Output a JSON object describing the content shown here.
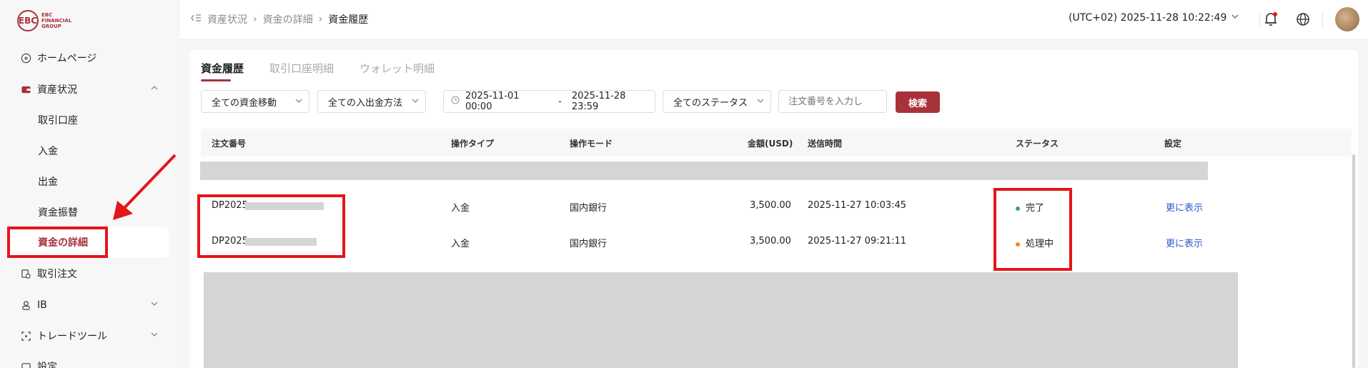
{
  "logo": {
    "mark": "EBC",
    "text": "EBC FINANCIAL GROUP"
  },
  "sidebar": {
    "home": "ホームページ",
    "assets": "資産状況",
    "sub": [
      "取引口座",
      "入金",
      "出金",
      "資金振替",
      "資金の詳細"
    ],
    "orders": "取引注文",
    "ib": "IB",
    "tools": "トレードツール",
    "settings": "設定"
  },
  "header": {
    "breadcrumb": [
      "資産状況",
      "資金の詳細",
      "資金履歴"
    ],
    "timezone": "(UTC+02)  2025-11-28 10:22:49"
  },
  "tabs": [
    "資金履歴",
    "取引口座明細",
    "ウォレット明細"
  ],
  "filters": {
    "movement": "全ての資金移動",
    "method": "全ての入出金方法",
    "date_from": "2025-11-01 00:00",
    "date_sep": "-",
    "date_to": "2025-11-28 23:59",
    "status": "全てのステータス",
    "order_placeholder": "注文番号を入力し",
    "search_button": "検索"
  },
  "table": {
    "headers": [
      "注文番号",
      "操作タイプ",
      "操作モード",
      "金額(USD)",
      "送信時間",
      "ステータス",
      "設定"
    ],
    "rows": [
      {
        "order": "DP2025",
        "type": "入金",
        "mode": "国内銀行",
        "amount": "3,500.00",
        "time": "2025-11-27 10:03:45",
        "status": "完了",
        "status_color": "#2aa876",
        "action": "更に表示"
      },
      {
        "order": "DP2025",
        "type": "入金",
        "mode": "国内銀行",
        "amount": "3,500.00",
        "time": "2025-11-27 09:21:11",
        "status": "処理中",
        "status_color": "#f08a24",
        "action": "更に表示"
      }
    ]
  },
  "colors": {
    "brand": "#a8323a",
    "annotation": "#e3161a",
    "link": "#2a5bd0"
  }
}
